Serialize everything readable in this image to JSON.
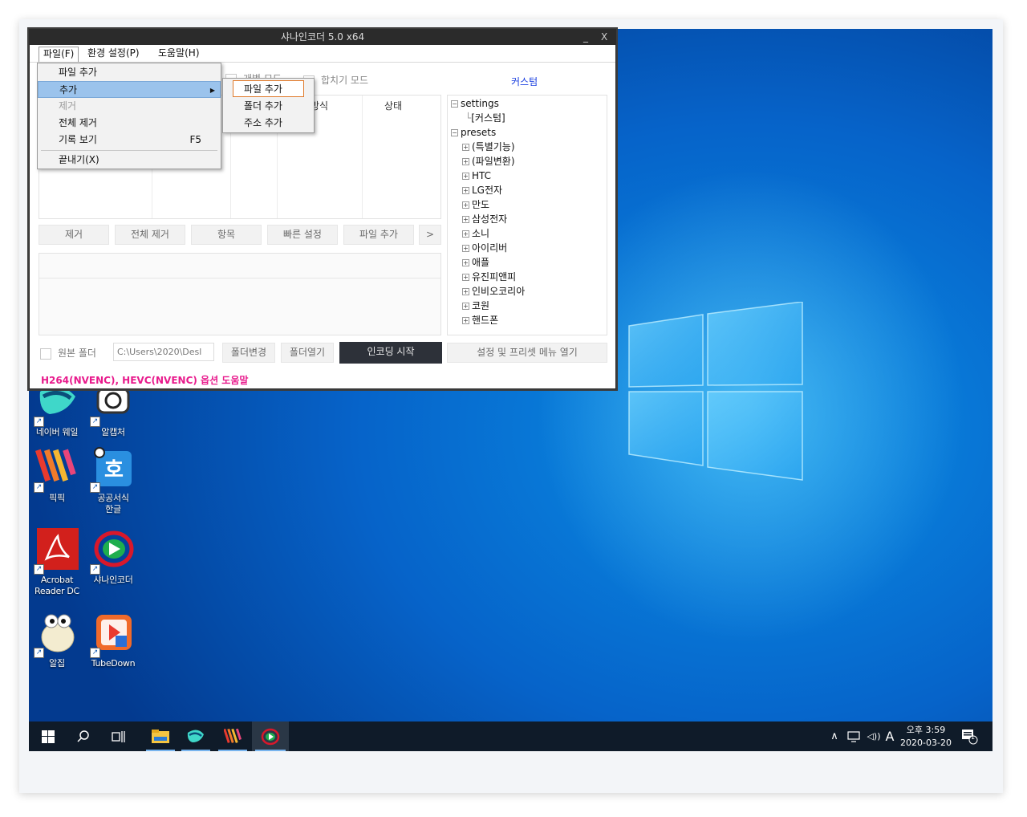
{
  "window": {
    "title": "샤나인코더  5.0 x64",
    "minimize": "_",
    "close": "X"
  },
  "menubar": {
    "file": "파일(F)",
    "settings": "환경 설정(P)",
    "help": "도움말(H)"
  },
  "file_menu": {
    "items": [
      "파일 추가",
      "추가",
      "제거",
      "전체 제거",
      "기록 보기",
      "끝내기(X)"
    ],
    "shortcut_history": "F5"
  },
  "add_submenu": {
    "items": [
      "파일 추가",
      "폴더 추가",
      "주소 추가"
    ]
  },
  "modes": {
    "individual": "개별 모드",
    "merge": "합치기 모드",
    "custom": "커스텀"
  },
  "list_headers": {
    "format": "방식",
    "status": "상태"
  },
  "buttons": {
    "remove": "제거",
    "remove_all": "전체 제거",
    "items": "항목",
    "quick_settings": "빠른 설정",
    "add_file": "파일 추가",
    "more": ">",
    "change_folder": "폴더변경",
    "open_folder": "폴더열기",
    "start_encoding": "인코딩 시작",
    "open_settings_menu": "설정 및 프리셋 메뉴 열기"
  },
  "source_folder": {
    "label": "원본 폴더",
    "path": "C:\\Users\\2020\\Desl"
  },
  "help_link": "H264(NVENC), HEVC(NVENC) 옵션 도움말",
  "tree": {
    "settings": "settings",
    "custom": "[커스텀]",
    "presets": "presets",
    "preset_items": [
      "(특별기능)",
      "(파일변환)",
      "HTC",
      "LG전자",
      "만도",
      "삼성전자",
      "소니",
      "아이리버",
      "애플",
      "유진피앤피",
      "인비오코리아",
      "코원",
      "핸드폰"
    ]
  },
  "desktop_icons": {
    "naver_whale": "네이버 웨일",
    "alcapture": "알캡처",
    "picpick": "픽픽",
    "hangul_line1": "공공서식",
    "hangul_line2": "한글",
    "acrobat_line1": "Acrobat",
    "acrobat_line2": "Reader DC",
    "shana": "샤나인코더",
    "alzip": "알집",
    "tubedown": "TubeDown"
  },
  "taskbar": {
    "clock_time": "오후 3:59",
    "clock_date": "2020-03-20",
    "ime": "A",
    "notification_count": "1",
    "icons": [
      "start-icon",
      "search-icon",
      "task-view-icon",
      "file-explorer-icon",
      "whale-icon",
      "picpick-icon",
      "shana-encoder-icon"
    ]
  },
  "colors": {
    "help_link": "#e81a8c",
    "custom_label": "#1a3fe0",
    "start_encoding_bg": "#2d3139",
    "submenu_highlight_border": "#e07a2a",
    "menu_highlight": "#9bc3ec"
  }
}
